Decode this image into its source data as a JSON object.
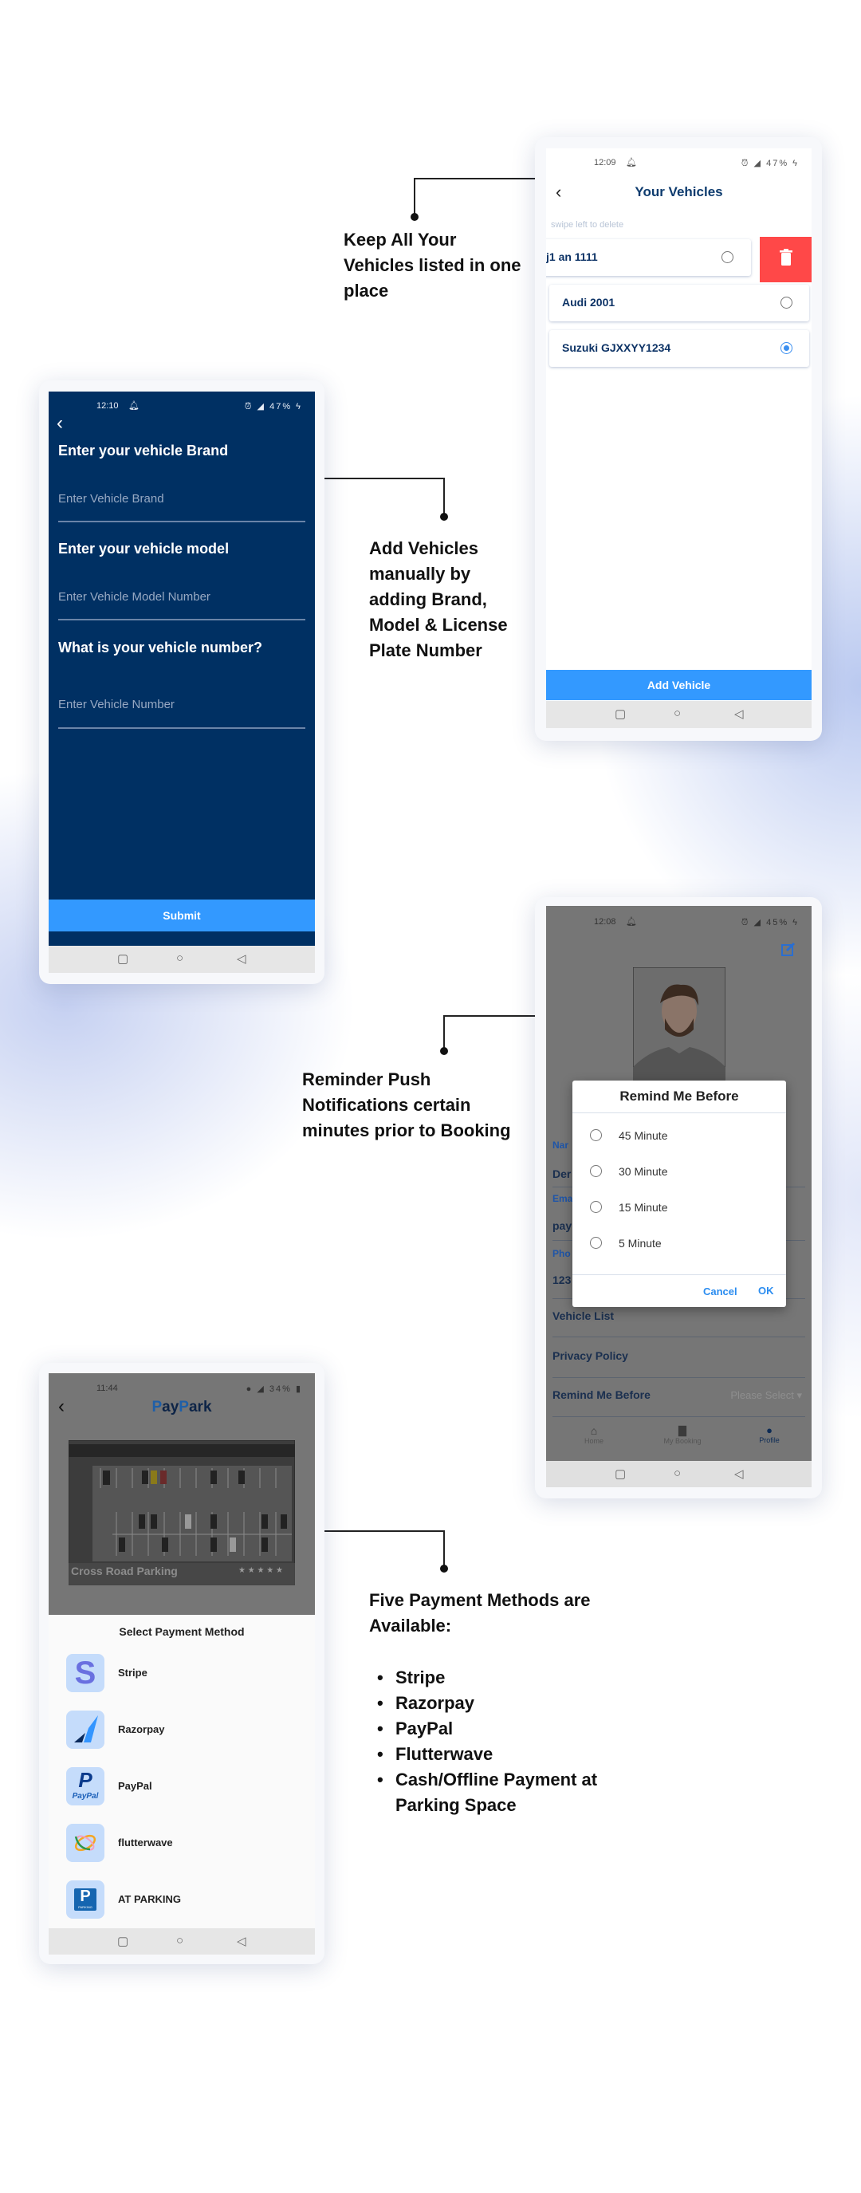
{
  "annotations": {
    "vehicles": [
      "Keep All Your",
      "Vehicles listed in one",
      "place"
    ],
    "add": [
      "Add Vehicles",
      "manually by",
      "adding Brand,",
      "Model & License",
      "Plate Number"
    ],
    "remind": [
      "Reminder Push",
      "Notifications certain",
      "minutes prior to Booking"
    ],
    "payment": {
      "intro": [
        "Five Payment Methods are",
        "Available:"
      ],
      "items": [
        "Stripe",
        "Razorpay",
        "PayPal",
        "Flutterwave",
        "Cash/Offline Payment at",
        "Parking Space"
      ]
    }
  },
  "your_vehicles": {
    "status": {
      "time": "12:09",
      "battery": "47%"
    },
    "title": "Your Vehicles",
    "hint": "swipe left to delete",
    "vehicles": [
      {
        "name": "j1 an 1111",
        "selected": false
      },
      {
        "name": "Audi  2001",
        "selected": false
      },
      {
        "name": "Suzuki  GJXXYY1234",
        "selected": true
      }
    ],
    "add_button": "Add Vehicle",
    "delete_color": "#ff4848"
  },
  "add_vehicle": {
    "status": {
      "time": "12:10",
      "battery": "47%"
    },
    "brand_q": "Enter  your vehicle Brand",
    "brand_ph": "Enter Vehicle Brand",
    "model_q": "Enter your vehicle model",
    "model_ph": "Enter Vehicle Model Number",
    "number_q": "What is your vehicle number?",
    "number_ph": "Enter Vehicle Number",
    "submit": "Submit",
    "bg_color": "#003063",
    "accent": "#3399ff"
  },
  "profile": {
    "status": {
      "time": "12:08",
      "battery": "45%"
    },
    "fields": [
      {
        "label": "Nar",
        "value": "Der"
      },
      {
        "label": "Ema",
        "value": "pay"
      },
      {
        "label": "Pho",
        "value": "123"
      }
    ],
    "links": [
      "Vehicle List",
      "Privacy Policy"
    ],
    "remind_label": "Remind Me Before",
    "remind_value": "Please Select",
    "tabs": [
      "Home",
      "My Booking",
      "Profile"
    ],
    "dialog": {
      "title": "Remind Me Before",
      "options": [
        "45 Minute",
        "30 Minute",
        "15 Minute",
        "5 Minute"
      ],
      "cancel": "Cancel",
      "ok": "OK"
    }
  },
  "payment": {
    "status": {
      "time": "11:44",
      "battery": "34%"
    },
    "brand": {
      "p1": "P",
      "a1": "ay",
      "p2": "P",
      "a2": "ark"
    },
    "parking_name": "Cross Road Parking",
    "rating": "★ ★ ★ ★ ★",
    "sheet_title": "Select Payment Method",
    "methods": [
      "Stripe",
      "Razorpay",
      "PayPal",
      "flutterwave",
      "AT PARKING"
    ],
    "paypal_logo": "PayPal",
    "parking_logo": "PARKING"
  }
}
